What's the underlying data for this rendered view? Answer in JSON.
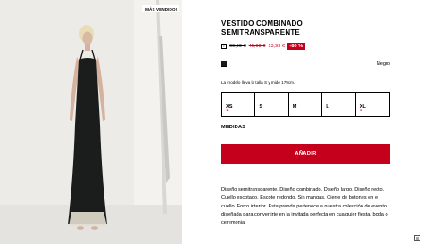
{
  "product": {
    "badge": "¡MÁS VENDIDO!",
    "title": "VESTIDO COMBINADO SEMITRANSPARENTE",
    "price": {
      "original": "69,99 €",
      "previous": "45,99 €",
      "current": "13,99 €",
      "discount": "-80 %"
    },
    "color": {
      "name": "Negro",
      "swatch": "#1a1a1a"
    },
    "model_note": "La modelo lleva la talla S y mide 179cm.",
    "sizes": [
      {
        "label": "XS",
        "low_stock": true
      },
      {
        "label": "S",
        "low_stock": false
      },
      {
        "label": "M",
        "low_stock": false
      },
      {
        "label": "L",
        "low_stock": false
      },
      {
        "label": "XL",
        "low_stock": true
      }
    ],
    "measures_label": "MEDIDAS",
    "add_button": "AÑADIR",
    "description": "Diseño semitransparente. Diseño combinado. Diseño largo. Diseño recto. Cuello escotado. Escote redondo. Sin mangas. Cierre de botones en el cuello. Forro interior. Esta prenda pertenece a nuestra colección de evento, diseñada para convertirte en la invitada perfecta en cualquier fiesta, boda o ceremonia"
  },
  "colors": {
    "accent": "#c4001c",
    "background_media": "#ececea"
  },
  "icons": {
    "info": "info-icon",
    "corner": "size-guide-icon"
  }
}
